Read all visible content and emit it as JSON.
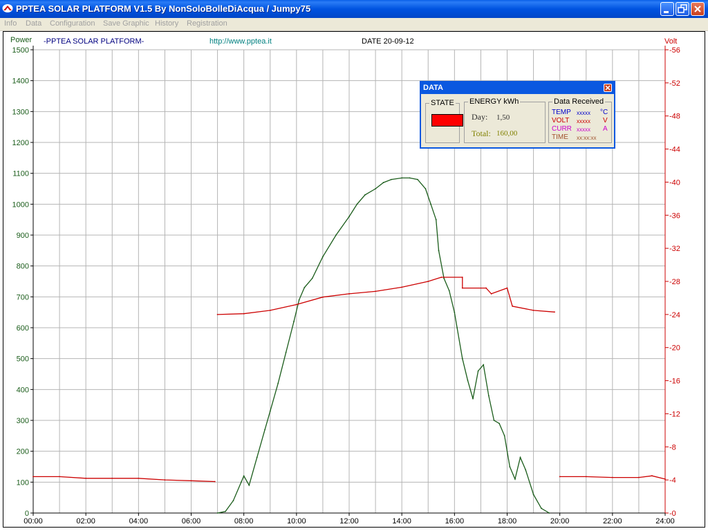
{
  "window": {
    "title": "PPTEA SOLAR PLATFORM V1.5  By NonSoloBolleDiAcqua / Jumpy75"
  },
  "icons": {
    "app": "solar-app-icon",
    "minimize": "minimize-icon",
    "restore": "restore-icon",
    "close": "close-icon"
  },
  "menu": {
    "items": [
      "Info",
      "Data",
      "Configuration",
      "Save Graphic",
      "History",
      "Registration"
    ]
  },
  "header": {
    "left_axis_title": "Power",
    "app_name": "-PPTEA SOLAR PLATFORM-",
    "url": "http://www.pptea.it",
    "date": "DATE 20-09-12",
    "right_axis_title": "Volt"
  },
  "colors": {
    "power": "#1a5c1a",
    "volt": "#cc0000",
    "grid": "#b4b4b4",
    "state": "#ff0000",
    "titlebar": "#0a58e0"
  },
  "chart_data": {
    "type": "line",
    "x_range": [
      "00:00",
      "24:00"
    ],
    "x_ticks": [
      "00:00",
      "02:00",
      "04:00",
      "06:00",
      "08:00",
      "10:00",
      "12:00",
      "14:00",
      "16:00",
      "18:00",
      "20:00",
      "22:00",
      "24:00"
    ],
    "y_left": {
      "label": "Power",
      "range": [
        0,
        1500
      ],
      "ticks": [
        0,
        100,
        200,
        300,
        400,
        500,
        600,
        700,
        800,
        900,
        1000,
        1100,
        1200,
        1300,
        1400,
        1500
      ]
    },
    "y_right": {
      "label": "Volt",
      "range": [
        0,
        56
      ],
      "ticks": [
        0,
        4,
        8,
        12,
        16,
        20,
        24,
        28,
        32,
        36,
        40,
        44,
        48,
        52,
        56
      ]
    },
    "grid": true,
    "series": [
      {
        "name": "Power",
        "axis": "left",
        "points": [
          [
            7.0,
            0
          ],
          [
            7.3,
            5
          ],
          [
            7.6,
            40
          ],
          [
            7.9,
            100
          ],
          [
            8.0,
            120
          ],
          [
            8.2,
            90
          ],
          [
            8.5,
            180
          ],
          [
            8.8,
            270
          ],
          [
            9.0,
            330
          ],
          [
            9.3,
            420
          ],
          [
            9.6,
            520
          ],
          [
            9.9,
            620
          ],
          [
            10.1,
            690
          ],
          [
            10.3,
            730
          ],
          [
            10.6,
            760
          ],
          [
            11.0,
            830
          ],
          [
            11.5,
            900
          ],
          [
            12.0,
            960
          ],
          [
            12.3,
            1000
          ],
          [
            12.6,
            1030
          ],
          [
            13.0,
            1050
          ],
          [
            13.3,
            1070
          ],
          [
            13.6,
            1080
          ],
          [
            14.0,
            1085
          ],
          [
            14.3,
            1085
          ],
          [
            14.6,
            1080
          ],
          [
            14.9,
            1050
          ],
          [
            15.1,
            1000
          ],
          [
            15.3,
            950
          ],
          [
            15.4,
            850
          ],
          [
            15.6,
            760
          ],
          [
            15.8,
            720
          ],
          [
            16.0,
            650
          ],
          [
            16.1,
            600
          ],
          [
            16.3,
            500
          ],
          [
            16.5,
            430
          ],
          [
            16.7,
            370
          ],
          [
            16.9,
            460
          ],
          [
            17.1,
            480
          ],
          [
            17.3,
            380
          ],
          [
            17.5,
            300
          ],
          [
            17.7,
            290
          ],
          [
            17.9,
            250
          ],
          [
            18.1,
            150
          ],
          [
            18.3,
            110
          ],
          [
            18.5,
            180
          ],
          [
            18.7,
            140
          ],
          [
            19.0,
            60
          ],
          [
            19.3,
            15
          ],
          [
            19.6,
            0
          ]
        ]
      },
      {
        "name": "Volt",
        "axis": "right",
        "points": [
          [
            0.0,
            4.4
          ],
          [
            1.0,
            4.4
          ],
          [
            2.0,
            4.2
          ],
          [
            3.0,
            4.2
          ],
          [
            4.0,
            4.2
          ],
          [
            5.0,
            4.0
          ],
          [
            6.0,
            3.9
          ],
          [
            6.9,
            3.8
          ],
          [
            7.0,
            24.0
          ],
          [
            8.0,
            24.1
          ],
          [
            9.0,
            24.5
          ],
          [
            10.0,
            25.2
          ],
          [
            11.0,
            26.1
          ],
          [
            12.0,
            26.5
          ],
          [
            13.0,
            26.8
          ],
          [
            14.0,
            27.3
          ],
          [
            15.0,
            28.0
          ],
          [
            15.5,
            28.5
          ],
          [
            16.3,
            28.5
          ],
          [
            16.3,
            27.2
          ],
          [
            17.2,
            27.2
          ],
          [
            17.4,
            26.5
          ],
          [
            18.0,
            27.2
          ],
          [
            18.2,
            25.0
          ],
          [
            19.0,
            24.5
          ],
          [
            19.8,
            24.3
          ],
          [
            20.0,
            4.4
          ],
          [
            21.0,
            4.4
          ],
          [
            22.0,
            4.3
          ],
          [
            23.0,
            4.3
          ],
          [
            23.5,
            4.5
          ],
          [
            24.0,
            4.1
          ]
        ]
      }
    ]
  },
  "data_panel": {
    "title": "DATA",
    "state": {
      "label": "STATE",
      "color": "#ff0000"
    },
    "energy": {
      "label": "ENERGY kWh",
      "day_label": "Day:",
      "day_value": "1,50",
      "total_label": "Total:",
      "total_value": "160,00"
    },
    "received": {
      "label": "Data Received",
      "rows": [
        {
          "name": "TEMP",
          "value": "xxxxx",
          "unit": "°C",
          "color": "#0000cc"
        },
        {
          "name": "VOLT",
          "value": "xxxxx",
          "unit": "V",
          "color": "#cc0000"
        },
        {
          "name": "CURR",
          "value": "xxxxx",
          "unit": "A",
          "color": "#cc00cc"
        },
        {
          "name": "TIME",
          "value": "xx:xx:xx",
          "unit": "",
          "color": "#a0522d"
        }
      ]
    }
  }
}
